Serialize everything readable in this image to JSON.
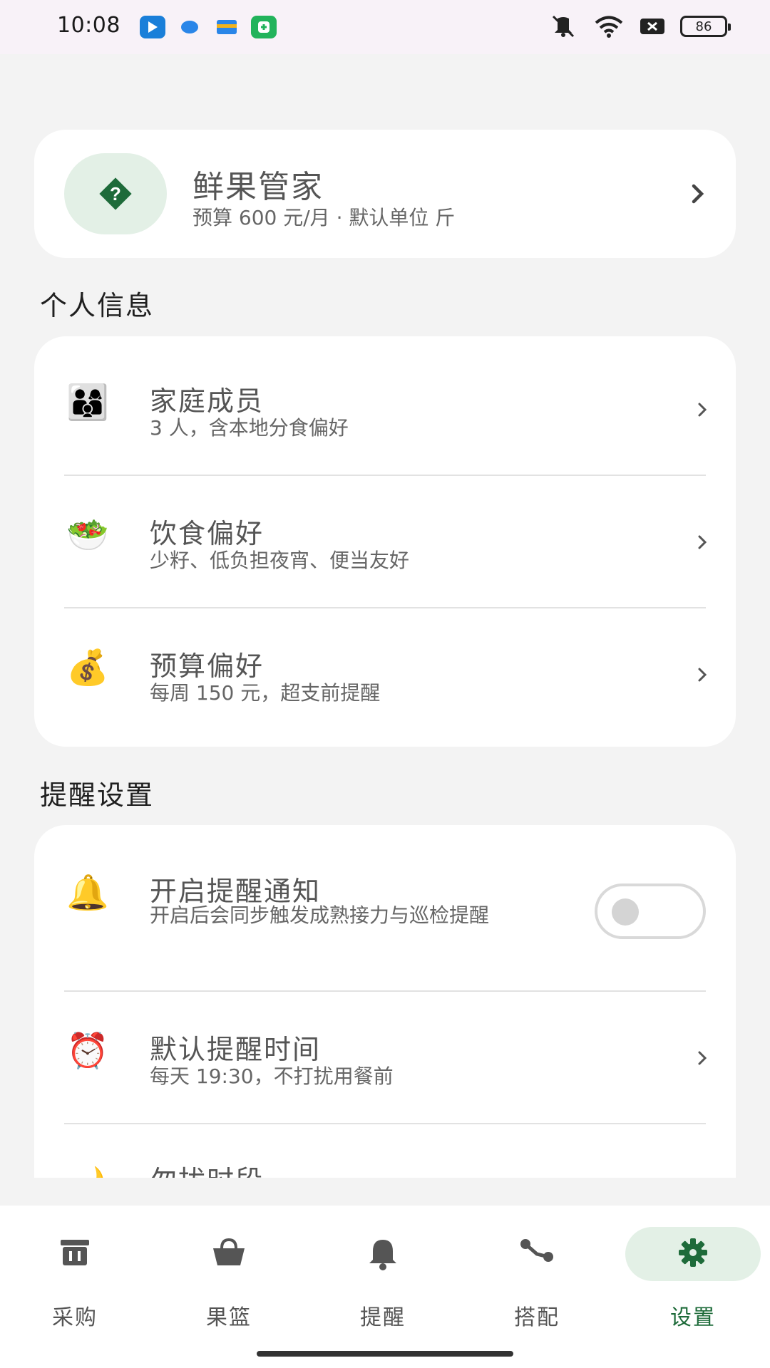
{
  "status_bar": {
    "time": "10:08",
    "battery": "86"
  },
  "profile": {
    "name": "鲜果管家",
    "subtitle": "预算 600 元/月 · 默认单位 斤"
  },
  "sections": {
    "personal": {
      "title": "个人信息",
      "items": [
        {
          "icon": "👨‍👩‍👦",
          "icon_name": "family-icon",
          "title": "家庭成员",
          "subtitle": "3 人，含本地分食偏好"
        },
        {
          "icon": "🥗",
          "icon_name": "salad-icon",
          "title": "饮食偏好",
          "subtitle": "少籽、低负担夜宵、便当友好"
        },
        {
          "icon": "💰",
          "icon_name": "money-bag-icon",
          "title": "预算偏好",
          "subtitle": "每周 150 元，超支前提醒"
        }
      ]
    },
    "reminder": {
      "title": "提醒设置",
      "notify": {
        "icon": "🔔",
        "icon_name": "bell-icon",
        "title": "开启提醒通知",
        "subtitle": "开启后会同步触发成熟接力与巡检提醒",
        "enabled": false
      },
      "default_time": {
        "icon": "⏰",
        "icon_name": "alarm-clock-icon",
        "title": "默认提醒时间",
        "subtitle": "每天 19:30，不打扰用餐前"
      },
      "quiet_hours": {
        "title": "勿扰时段"
      }
    }
  },
  "nav": {
    "items": [
      {
        "label": "采购",
        "icon_name": "purchase-icon"
      },
      {
        "label": "果篮",
        "icon_name": "basket-icon"
      },
      {
        "label": "提醒",
        "icon_name": "bell-icon"
      },
      {
        "label": "搭配",
        "icon_name": "pairing-icon"
      },
      {
        "label": "设置",
        "icon_name": "settings-icon"
      }
    ],
    "active": "设置"
  },
  "colors": {
    "accent": "#1e6b3a",
    "accent_light": "#e3f0e6",
    "background": "#f3f3f3",
    "card": "#ffffff"
  }
}
